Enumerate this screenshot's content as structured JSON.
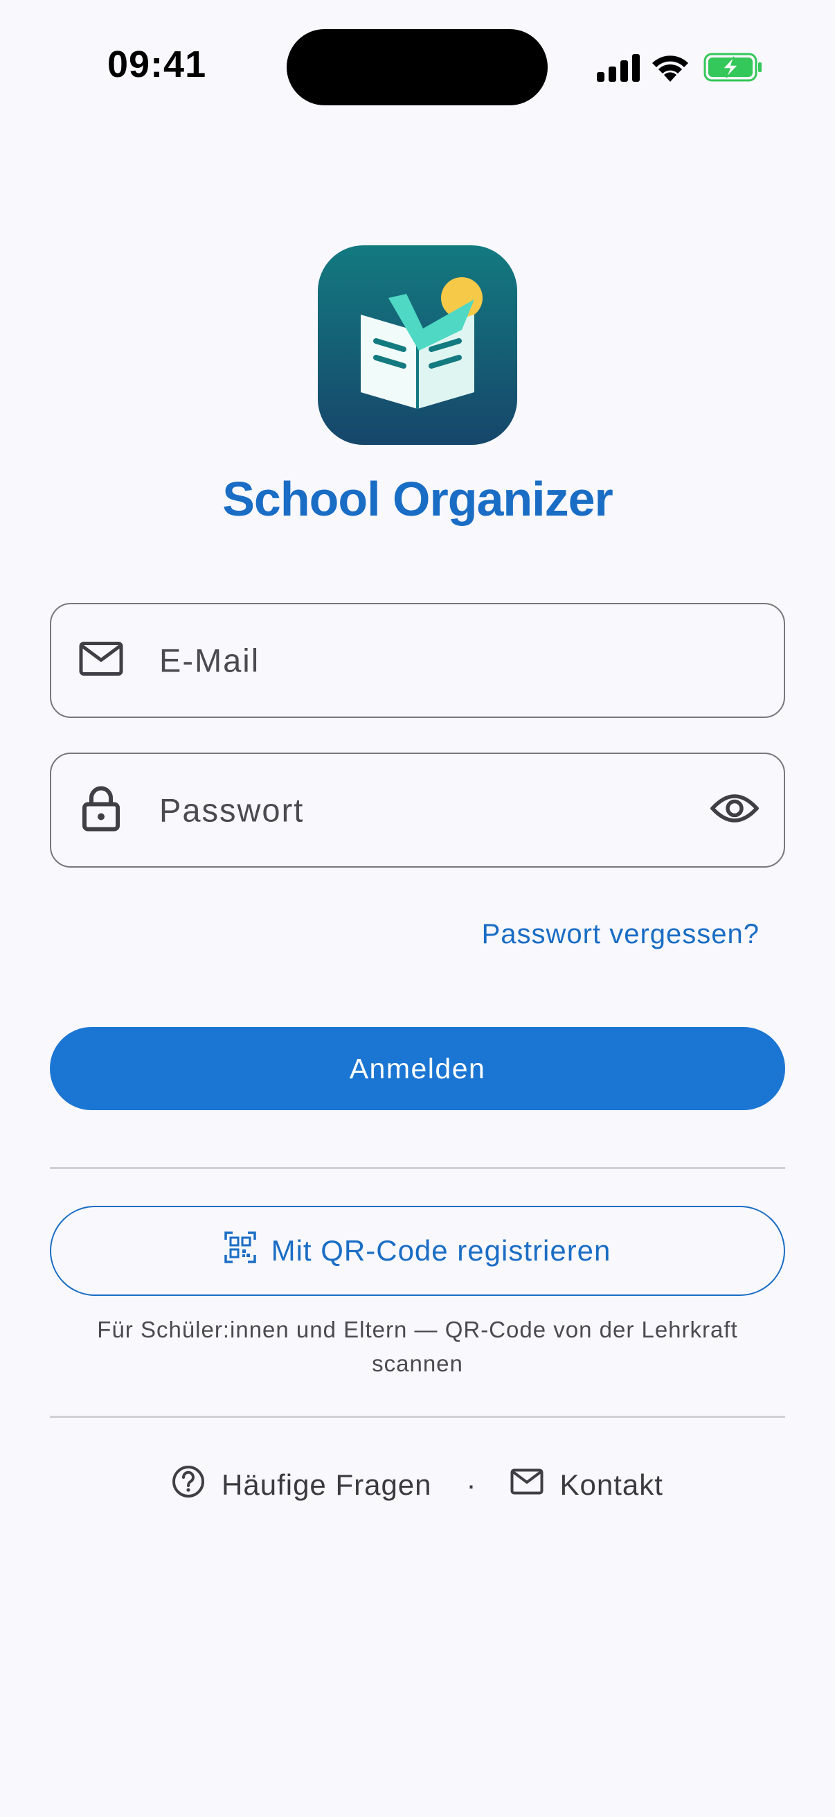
{
  "status_bar": {
    "time": "09:41",
    "icons": [
      "cellular-signal-icon",
      "wifi-icon",
      "battery-charging-icon"
    ],
    "battery_color": "#34c759"
  },
  "app": {
    "name": "School Organizer",
    "logo_icon": "open-book-checkmark-icon"
  },
  "login_form": {
    "email": {
      "placeholder": "E-Mail",
      "value": "",
      "icon": "mail-icon"
    },
    "password": {
      "placeholder": "Passwort",
      "value": "",
      "icon": "lock-icon",
      "toggle_icon": "eye-icon"
    },
    "forgot_password": "Passwort vergessen?",
    "submit": "Anmelden"
  },
  "qr_register": {
    "label": "Mit QR-Code registrieren",
    "icon": "qr-code-icon",
    "hint": "Für Schüler:innen und Eltern — QR-Code von der Lehrkraft scannen"
  },
  "footer": {
    "faq": {
      "label": "Häufige Fragen",
      "icon": "help-circle-icon"
    },
    "separator": "·",
    "contact": {
      "label": "Kontakt",
      "icon": "mail-icon"
    }
  },
  "colors": {
    "primary": "#1b76d3",
    "title": "#1a6dc4",
    "background": "#f8f8fd",
    "logo_gradient_top": "#137a80",
    "logo_gradient_bottom": "#16466a"
  }
}
